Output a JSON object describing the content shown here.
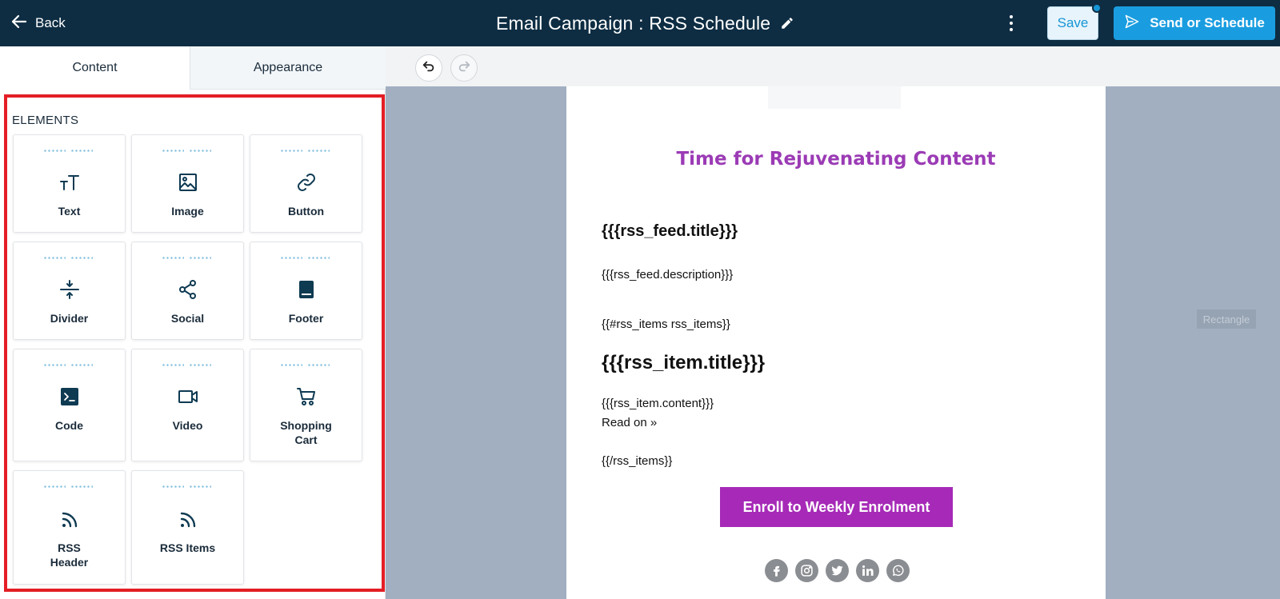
{
  "header": {
    "back_label": "Back",
    "title": "Email Campaign : RSS Schedule",
    "save_label": "Save",
    "send_label": "Send or Schedule"
  },
  "left_panel": {
    "tabs": [
      {
        "label": "Content",
        "active": true
      },
      {
        "label": "Appearance",
        "active": false
      }
    ],
    "elements_heading": "ELEMENTS",
    "elements": [
      {
        "label": "Text",
        "icon": "text-icon"
      },
      {
        "label": "Image",
        "icon": "image-icon"
      },
      {
        "label": "Button",
        "icon": "link-icon"
      },
      {
        "label": "Divider",
        "icon": "divider-icon"
      },
      {
        "label": "Social",
        "icon": "share-icon"
      },
      {
        "label": "Footer",
        "icon": "footer-icon"
      },
      {
        "label": "Code",
        "icon": "terminal-icon"
      },
      {
        "label": "Video",
        "icon": "video-icon"
      },
      {
        "label": "Shopping\nCart",
        "icon": "cart-icon"
      },
      {
        "label": "RSS\nHeader",
        "icon": "rss-icon"
      },
      {
        "label": "RSS Items",
        "icon": "rss-icon"
      }
    ]
  },
  "email": {
    "headline": "Time for Rejuvenating Content",
    "feed_title": "{{{rss_feed.title}}}",
    "feed_description": "{{{rss_feed.description}}}",
    "items_open": "{{#rss_items rss_items}}",
    "item_title": "{{{rss_item.title}}}",
    "item_content": "{{{rss_item.content}}}",
    "read_on": "Read on »",
    "items_close": "{{/rss_items}}",
    "cta_label": "Enroll to Weekly Enrolment",
    "social_icons": [
      "facebook-icon",
      "instagram-icon",
      "twitter-icon",
      "linkedin-icon",
      "whatsapp-icon"
    ]
  },
  "canvas": {
    "rectangle_label": "Rectangle"
  },
  "colors": {
    "topbar": "#0e2d43",
    "accent_blue": "#1a9de0",
    "headline_purple": "#9b3bb5",
    "cta_purple": "#a62ab7",
    "highlight_red": "#e31e24",
    "canvas_bg": "#a1afc1"
  }
}
